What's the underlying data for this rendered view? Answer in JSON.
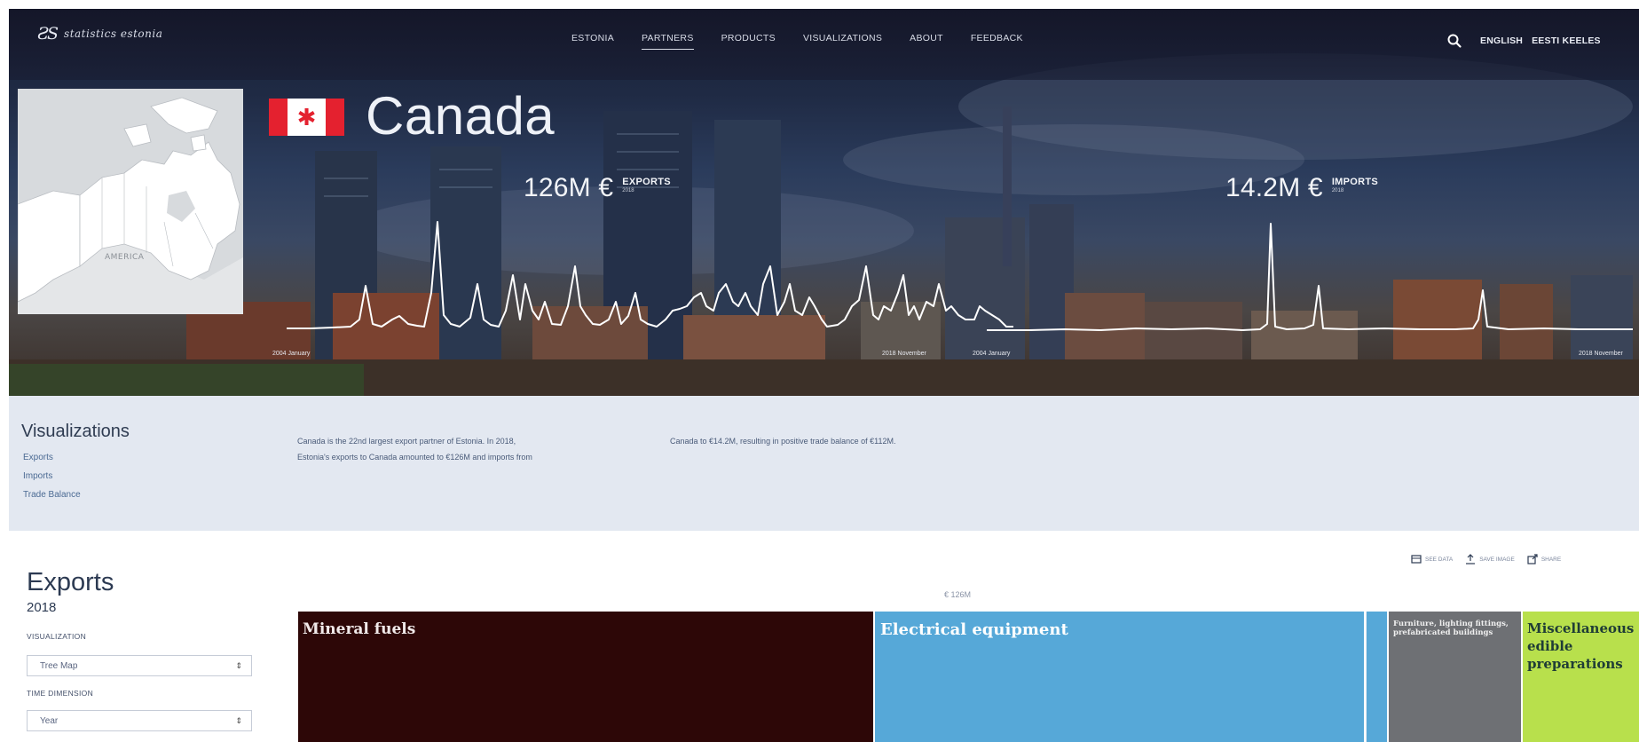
{
  "header": {
    "logo_mark": "ƧS",
    "logo_text": "statistics estonia",
    "nav": [
      {
        "label": "ESTONIA",
        "active": false
      },
      {
        "label": "PARTNERS",
        "active": true
      },
      {
        "label": "PRODUCTS",
        "active": false
      },
      {
        "label": "VISUALIZATIONS",
        "active": false
      },
      {
        "label": "ABOUT",
        "active": false
      },
      {
        "label": "FEEDBACK",
        "active": false
      }
    ],
    "search_icon": "search-icon",
    "lang_english": "ENGLISH",
    "lang_estonian": "EESTI KEELES"
  },
  "hero": {
    "country": "Canada",
    "flag_symbol": "✱",
    "map_label": "AMERICA",
    "exports": {
      "value": "126M €",
      "label": "EXPORTS",
      "year": "2018"
    },
    "imports": {
      "value": "14.2M €",
      "label": "IMPORTS",
      "year": "2018"
    },
    "export_axis": {
      "start": "2004 January",
      "end": "2018 November"
    },
    "import_axis": {
      "start": "2004 January",
      "end": "2018 November"
    },
    "line_color": "#ffffff"
  },
  "visualizations": {
    "title": "Visualizations",
    "links": [
      "Exports",
      "Imports",
      "Trade Balance"
    ],
    "blurb_1": "Canada is the 22nd largest export partner of Estonia. In 2018,",
    "blurb_2": "Estonia's exports to Canada amounted to €126M and imports from",
    "blurb_3": "Canada to €14.2M, resulting in positive trade balance of €112M."
  },
  "exports_section": {
    "title": "Exports",
    "year": "2018",
    "visualization_label": "VISUALIZATION",
    "visualization_value": "Tree Map",
    "time_label": "TIME DIMENSION",
    "time_value": "Year",
    "tools": {
      "data": "SEE DATA",
      "save": "SAVE IMAGE",
      "share": "SHARE"
    },
    "total": "€ 126M",
    "tiles": [
      {
        "label": "Mineral fuels",
        "color": "#2d0707"
      },
      {
        "label": "Electrical equipment",
        "color": "#56a8d8"
      },
      {
        "label": "",
        "color": "#56a8d8"
      },
      {
        "label": "Furniture, lighting fittings, prefabricated buildings",
        "color": "#6e7074"
      },
      {
        "label": "Miscellaneous edible preparations",
        "color": "#b8e04c"
      }
    ]
  }
}
